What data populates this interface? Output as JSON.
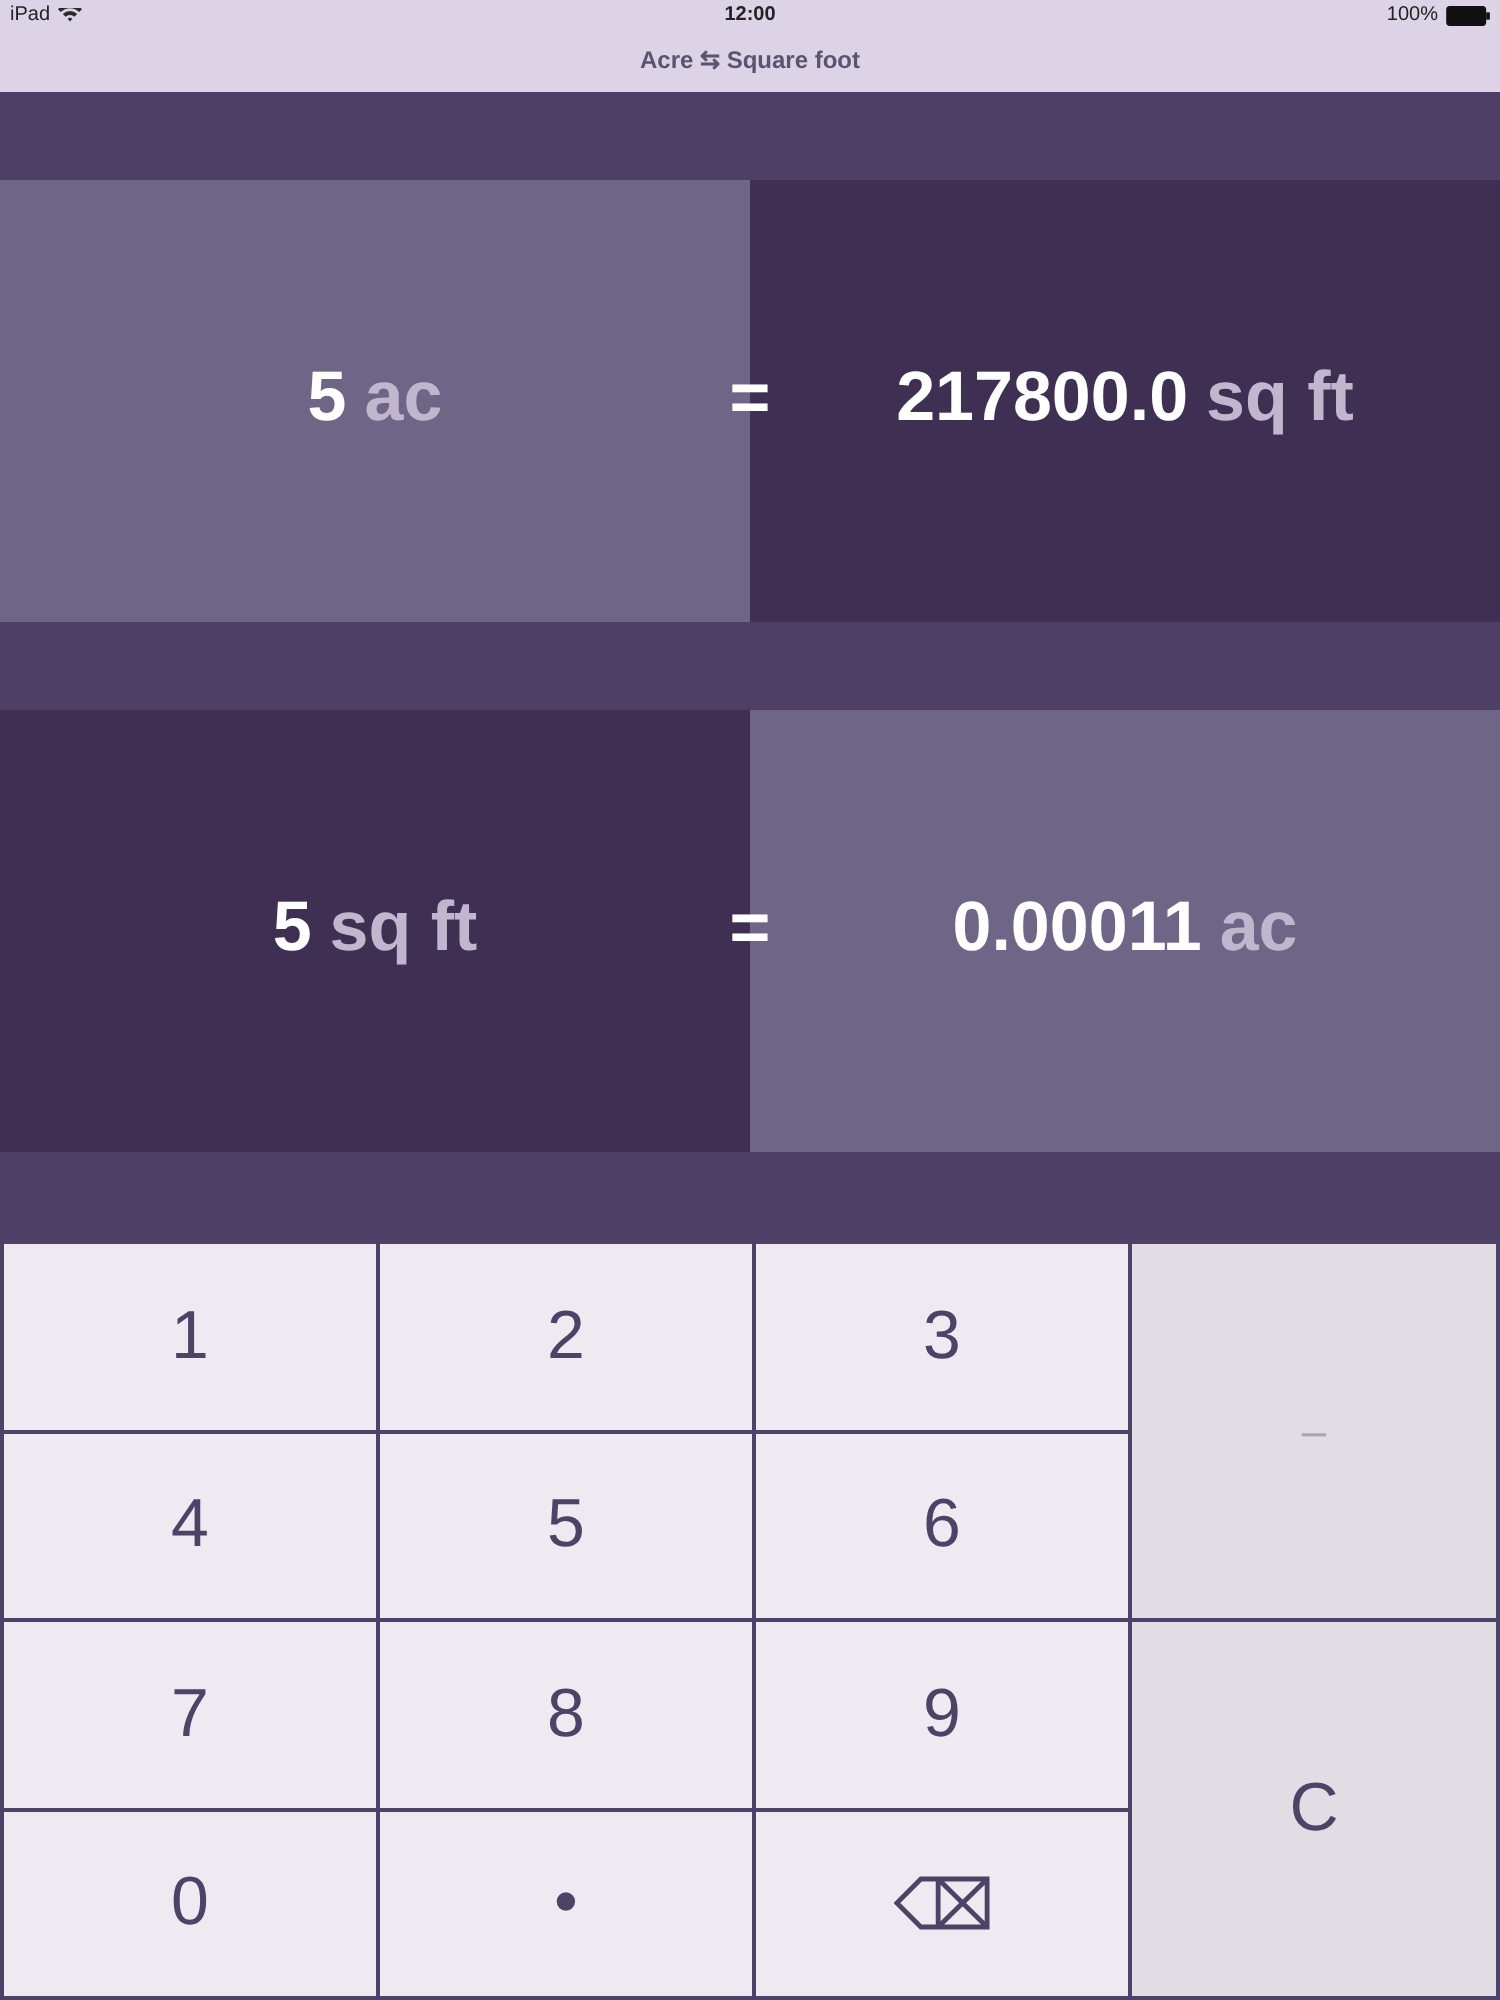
{
  "status_bar": {
    "device": "iPad",
    "time": "12:00",
    "battery": "100%"
  },
  "nav_bar": {
    "title": "Acre ⇆ Square foot"
  },
  "conversions": [
    {
      "input": {
        "value": "5",
        "unit": "ac",
        "selected": true
      },
      "equals": "=",
      "output": {
        "value": "217800.0",
        "unit": "sq ft",
        "selected": false
      }
    },
    {
      "input": {
        "value": "5",
        "unit": "sq ft",
        "selected": false
      },
      "equals": "=",
      "output": {
        "value": "0.00011",
        "unit": "ac",
        "selected": true
      }
    }
  ],
  "keypad": [
    {
      "kind": "digit",
      "label": "1",
      "disabled": false
    },
    {
      "kind": "digit",
      "label": "2",
      "disabled": false
    },
    {
      "kind": "digit",
      "label": "3",
      "disabled": false
    },
    {
      "kind": "minus",
      "label": "–",
      "disabled": true
    },
    {
      "kind": "digit",
      "label": "4",
      "disabled": false
    },
    {
      "kind": "digit",
      "label": "5",
      "disabled": false
    },
    {
      "kind": "digit",
      "label": "6",
      "disabled": false
    },
    {
      "kind": "digit",
      "label": "7",
      "disabled": false
    },
    {
      "kind": "digit",
      "label": "8",
      "disabled": false
    },
    {
      "kind": "digit",
      "label": "9",
      "disabled": false
    },
    {
      "kind": "clear",
      "label": "C",
      "disabled": false
    },
    {
      "kind": "digit",
      "label": "0",
      "disabled": false
    },
    {
      "kind": "decimal",
      "label": "•",
      "disabled": false
    },
    {
      "kind": "backspace",
      "disabled": false
    }
  ]
}
